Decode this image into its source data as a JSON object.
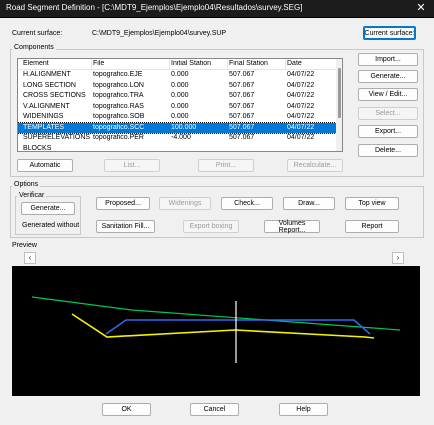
{
  "window": {
    "title": "Road Segment Definition - [C:\\MDT9_Ejemplos\\Ejemplo04\\Resultados\\survey.SEG]",
    "close_glyph": "✕"
  },
  "surface": {
    "label": "Current surface:",
    "value": "C:\\MDT9_Ejemplos\\Ejemplo04\\survey.SUP",
    "button": "Current surface:"
  },
  "components": {
    "group_label": "Components",
    "columns": [
      "Element",
      "File",
      "Initial Station",
      "Final Station",
      "Date"
    ],
    "rows": [
      [
        "H.ALIGNMENT",
        "topografico.EJE",
        "0.000",
        "507.067",
        "04/07/22"
      ],
      [
        "LONG SECTION",
        "topografico.LON",
        "0.000",
        "507.067",
        "04/07/22"
      ],
      [
        "CROSS SECTIONS",
        "topografico.TRA",
        "0.000",
        "507.067",
        "04/07/22"
      ],
      [
        "V.ALIGNMENT",
        "topografico.RAS",
        "0.000",
        "507.067",
        "04/07/22"
      ],
      [
        "WIDENINGS",
        "topografico.SOB",
        "0.000",
        "507.067",
        "04/07/22"
      ],
      [
        "TEMPLATES",
        "topografico.SCC",
        "100.000",
        "507.067",
        "04/07/22"
      ],
      [
        "SUPERELEVATIONS",
        "topografico.PER",
        "-4.000",
        "507.067",
        "04/07/22"
      ],
      [
        "BLOCKS",
        "",
        "",
        "",
        ""
      ]
    ],
    "selected_index": 5,
    "side_buttons": {
      "import": "Import...",
      "generate": "Generate...",
      "view_edit": "View / Edit...",
      "select": "Select...",
      "export": "Export...",
      "delete": "Delete..."
    },
    "bottom_buttons": {
      "automatic": "Automatic",
      "list": "List...",
      "print": "Print...",
      "recalculate": "Recalculate..."
    }
  },
  "options": {
    "group_label": "Options",
    "verificar_label": "Verificar",
    "generate": "Generate...",
    "generated_without": "Generated without",
    "proposed": "Proposed...",
    "widenings": "Widenings",
    "check": "Check...",
    "draw": "Draw...",
    "top_view": "Top view",
    "sanitation_fill": "Sanitation Fill...",
    "export_boxing": "Export boxing",
    "volumes_report": "Volumes Report...",
    "report": "Report"
  },
  "preview": {
    "label": "Preview",
    "prev_glyph": "‹",
    "next_glyph": "›",
    "colors": {
      "background": "#000000",
      "terrain": "#00c853",
      "template": "#f4f400",
      "subgrade": "#2f6df0",
      "axis": "#ffffff"
    }
  },
  "footer": {
    "ok": "OK",
    "cancel": "Cancel",
    "help": "Help"
  }
}
